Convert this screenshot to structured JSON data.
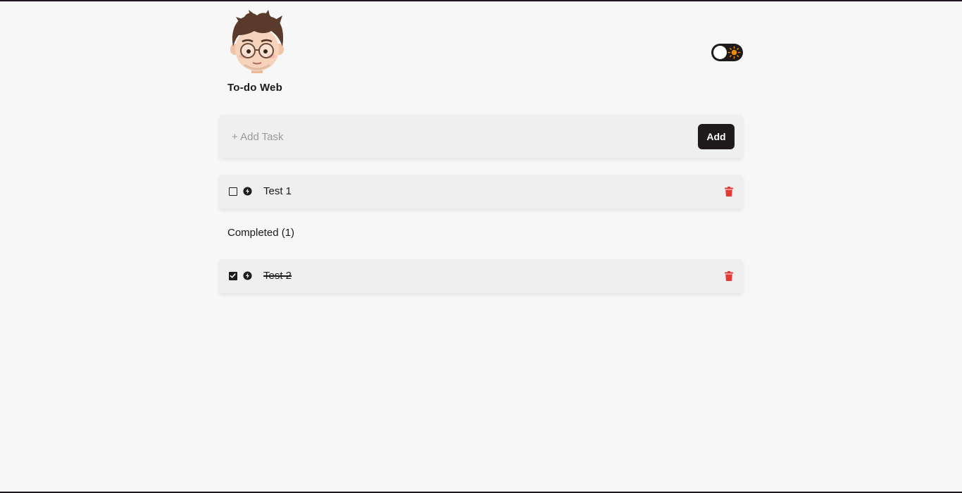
{
  "app": {
    "title": "To-do Web"
  },
  "theme_toggle": {
    "mode": "light",
    "knob_icon": "circle-knob",
    "indicator_icon": "sun-icon",
    "indicator_color": "#f08a00"
  },
  "add_task": {
    "placeholder": "+ Add Task",
    "value": "",
    "button_label": "Add"
  },
  "tasks": [
    {
      "label": "Test 1",
      "completed": false
    }
  ],
  "completed_section": {
    "heading": "Completed (1)",
    "tasks": [
      {
        "label": "Test 2",
        "completed": true
      }
    ]
  },
  "colors": {
    "background": "#f7f7f7",
    "card": "#efefef",
    "accent_dark": "#1f1a1c",
    "delete_red": "#e53935"
  }
}
